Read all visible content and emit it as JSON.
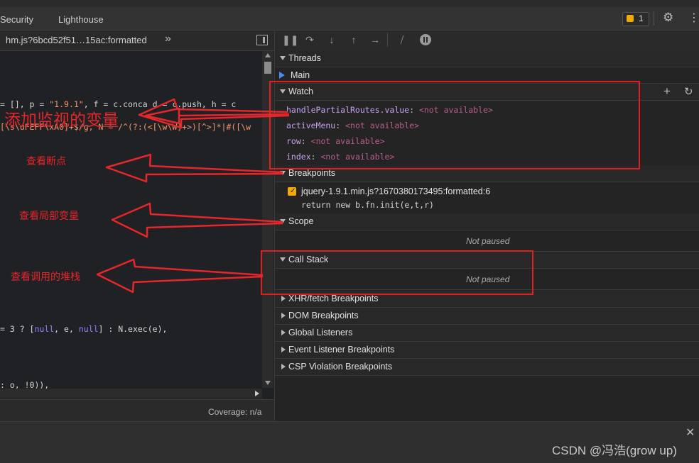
{
  "top_tabs": [
    "Security",
    "Lighthouse"
  ],
  "issues_count": "1",
  "source": {
    "filename": "hm.js?6bcd52f51…15ac:formatted",
    "chevrons": "»",
    "code_lines": [
      {
        "t": "= [], p = ",
        "s": "\"1.9.1\"",
        "r": ", f = c.conca​ d = c.push, h = c"
      },
      {
        "t": "[\\s\\uFEFF\\xA0]+$/g, N = /^(?:(<[\\w\\W]+>)[^>]*|#([\\w"
      },
      {
        "t": "= 3 ? [",
        "k1": "null",
        "m": ", e, ",
        "k2": "null",
        "e": "] : N.exec(e),"
      },
      {
        "t": ": o, !0)),"
      }
    ],
    "coverage": "Coverage: n/a"
  },
  "debugger": {
    "sections": {
      "threads": "Threads",
      "main": "Main",
      "watch": "Watch",
      "breakpoints": "Breakpoints",
      "scope": "Scope",
      "call_stack": "Call Stack",
      "xhr": "XHR/fetch Breakpoints",
      "dom": "DOM Breakpoints",
      "global": "Global Listeners",
      "event": "Event Listener Breakpoints",
      "csp": "CSP Violation Breakpoints"
    },
    "watch_items": [
      {
        "key": "handlePartialRoutes.value",
        "value": "<not available>"
      },
      {
        "key": "activeMenu",
        "value": "<not available>"
      },
      {
        "key": "row",
        "value": "<not available>"
      },
      {
        "key": "index",
        "value": "<not available>"
      }
    ],
    "breakpoint": {
      "location": "jquery-1.9.1.min.js?1670380173495:formatted:6",
      "code": "return new b.fn.init(e,t,r)"
    },
    "scope_status": "Not paused",
    "callstack_status": "Not paused"
  },
  "annotations": {
    "watch_note": "添加监视的变量",
    "breakpoints_note": "查看断点",
    "scope_note": "查看局部变量",
    "callstack_note": "查看调用的堆栈"
  },
  "watermark": "CSDN @冯浩(grow up)",
  "colors": {
    "annotation": "#e5262b",
    "string": "#f29766",
    "keyword": "#9980ff"
  }
}
